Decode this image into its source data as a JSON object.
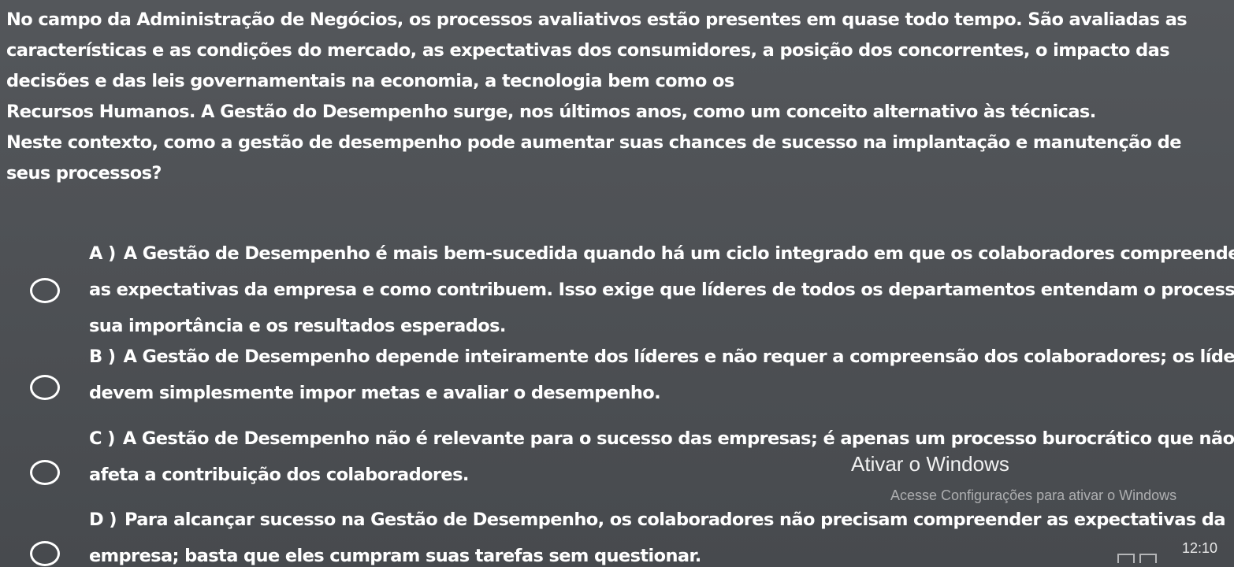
{
  "question": {
    "lines": [
      "No campo da Administração de Negócios, os processos avaliativos estão presentes em quase todo tempo. São avaliadas as",
      "características e as condições do mercado, as expectativas dos consumidores, a posição dos concorrentes, o impacto das",
      "decisões e das leis governamentais na economia, a tecnologia bem como os",
      "Recursos Humanos. A Gestão do Desempenho surge, nos últimos anos, como um conceito alternativo às técnicas.",
      "Neste contexto, como a gestão de desempenho pode aumentar suas chances de sucesso na implantação e manutenção de",
      "seus processos?"
    ]
  },
  "options": [
    {
      "letter": "A )",
      "lines": [
        "A Gestão de Desempenho é mais bem-sucedida quando há um ciclo integrado em que os colaboradores compreendem",
        "as expectativas da empresa e como contribuem. Isso exige que líderes de todos os departamentos entendam o processo,",
        "sua importância e os resultados esperados."
      ]
    },
    {
      "letter": "B )",
      "lines": [
        "A Gestão de Desempenho depende inteiramente dos líderes e não requer a compreensão dos colaboradores; os líderes",
        "devem simplesmente impor metas e avaliar o desempenho."
      ]
    },
    {
      "letter": "C )",
      "lines": [
        "A Gestão de Desempenho não é relevante para o sucesso das empresas; é apenas um processo burocrático que não",
        "afeta a contribuição dos colaboradores."
      ]
    },
    {
      "letter": "D )",
      "lines": [
        "Para alcançar sucesso na Gestão de Desempenho, os colaboradores não precisam compreender as expectativas da",
        "empresa; basta que eles cumpram suas tarefas sem questionar."
      ]
    }
  ],
  "watermark": {
    "title": "Ativar o Windows",
    "subtitle": "Acesse Configurações para ativar o Windows"
  },
  "taskbar": {
    "clock": "12:10"
  }
}
